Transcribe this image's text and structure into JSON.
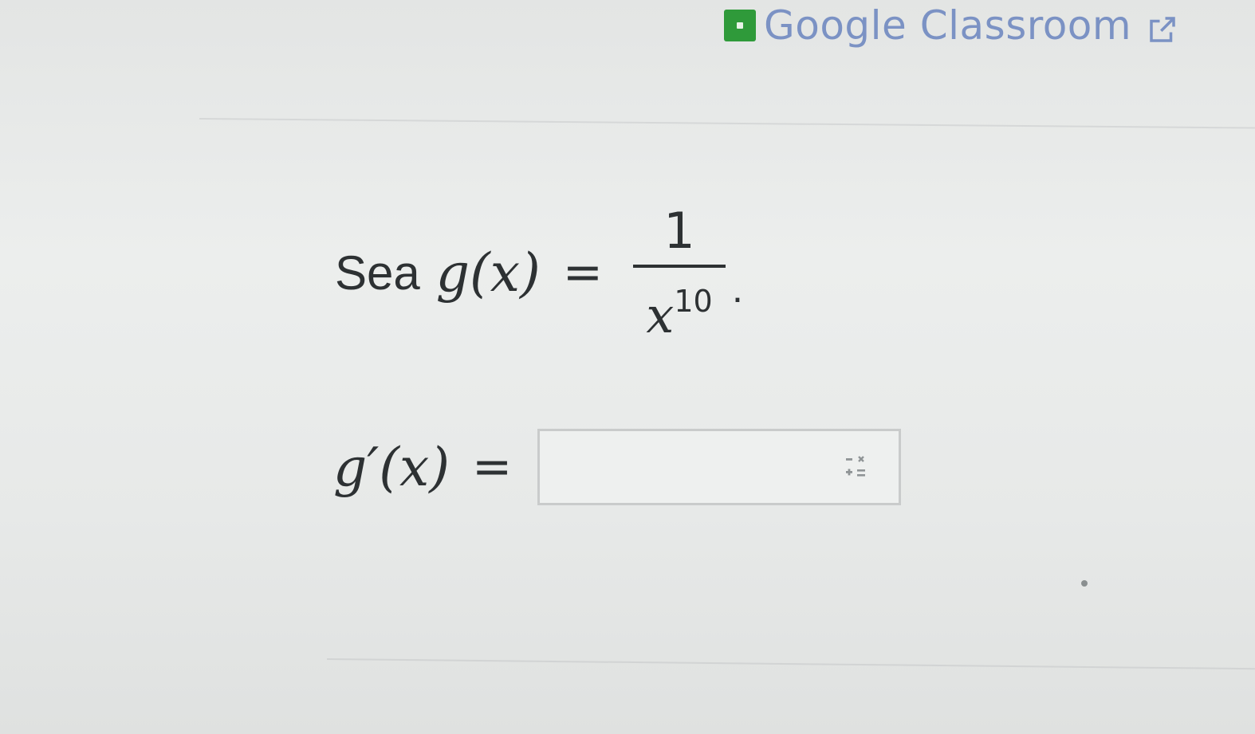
{
  "header": {
    "classroom_label": "Google Classroom",
    "icon": "google-classroom-icon",
    "external_icon": "external-link-icon",
    "link_color": "#7b92c4",
    "icon_color": "#2f9a3a"
  },
  "problem": {
    "intro": "Sea",
    "lhs": "g(x)",
    "equals": "=",
    "numerator": "1",
    "denominator_base": "x",
    "denominator_exponent": "10",
    "period": "."
  },
  "answer": {
    "lhs": "g′(x)",
    "equals": "=",
    "value": "",
    "placeholder": "",
    "keypad_icon": "math-keypad-icon"
  }
}
